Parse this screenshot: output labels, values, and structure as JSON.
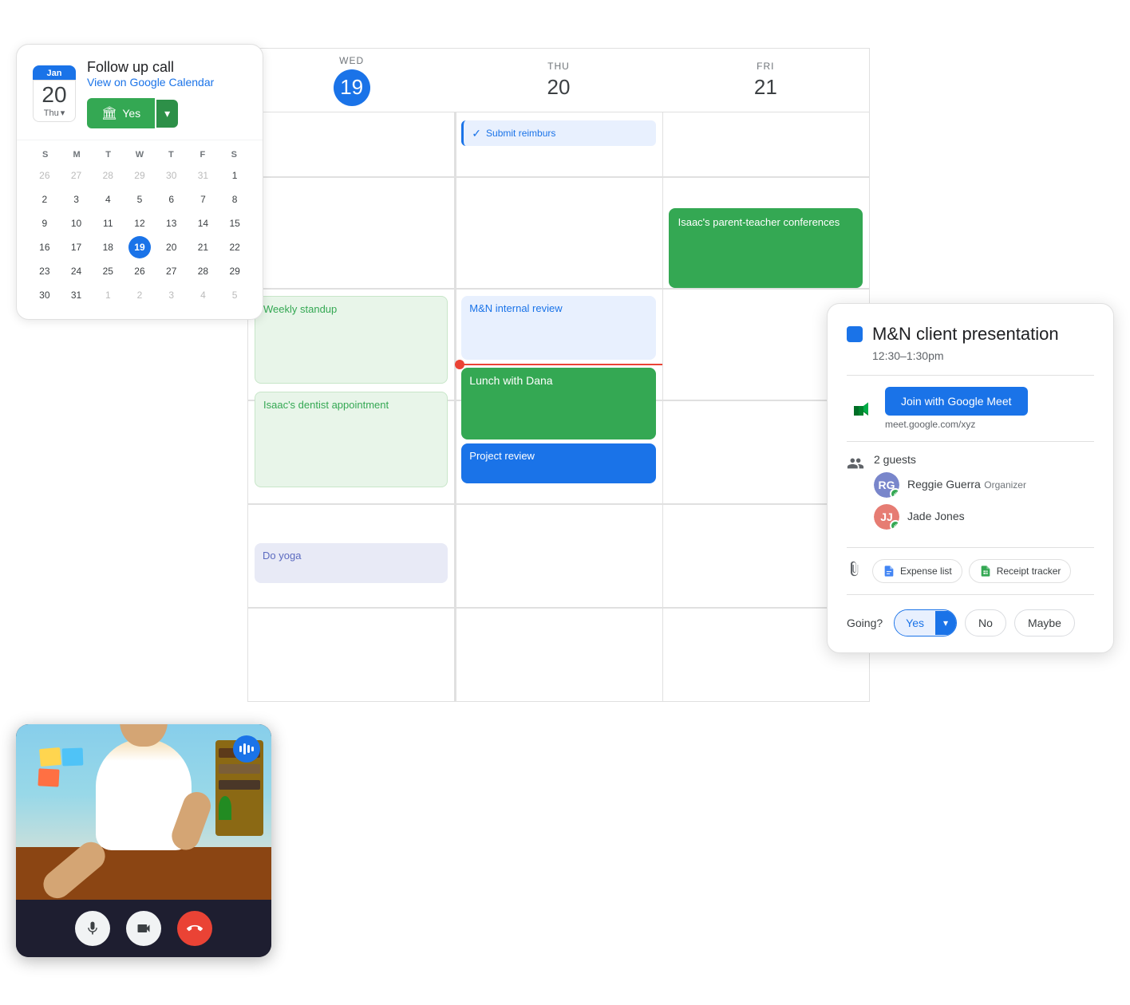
{
  "calendar": {
    "days": [
      {
        "name": "WED",
        "num": "19",
        "active": true
      },
      {
        "name": "THU",
        "num": "20",
        "active": false
      },
      {
        "name": "FRI",
        "num": "21",
        "active": false
      }
    ],
    "events": {
      "wed": [
        {
          "id": "submit",
          "label": "Submit reimburs",
          "type": "task"
        },
        {
          "id": "mn-internal",
          "label": "M&N internal review",
          "type": "blue-light"
        },
        {
          "id": "lunch-dana",
          "label": "Lunch with Dana",
          "type": "green"
        },
        {
          "id": "project-review",
          "label": "Project review",
          "type": "blue"
        }
      ],
      "thu": [
        {
          "id": "isaac-parent",
          "label": "Isaac's parent-teacher conferences",
          "type": "green-dark"
        }
      ],
      "fri": [],
      "col1": [
        {
          "id": "weekly-standup",
          "label": "Weekly standup",
          "type": "green-light"
        },
        {
          "id": "dentist",
          "label": "Isaac's dentist appointment",
          "type": "green-light"
        },
        {
          "id": "yoga",
          "label": "Do yoga",
          "type": "purple-light"
        }
      ]
    }
  },
  "mini_calendar": {
    "title": "Follow up call",
    "view_link": "View on Google Calendar",
    "month": "Jan",
    "day_num": "20",
    "day_name": "Thu",
    "rsvp_yes": "Yes",
    "headers": [
      "S",
      "M",
      "T",
      "W",
      "T",
      "F",
      "S"
    ],
    "weeks": [
      [
        "26",
        "27",
        "28",
        "29",
        "30",
        "31",
        "1"
      ],
      [
        "2",
        "3",
        "4",
        "5",
        "6",
        "7",
        "8"
      ],
      [
        "9",
        "10",
        "11",
        "12",
        "13",
        "14",
        "15"
      ],
      [
        "16",
        "17",
        "18",
        "19",
        "20",
        "21",
        "22"
      ],
      [
        "23",
        "24",
        "25",
        "26",
        "27",
        "28",
        "29"
      ],
      [
        "30",
        "31",
        "1",
        "2",
        "3",
        "4",
        "5"
      ]
    ],
    "today_index": "19",
    "other_month_start": [
      0,
      1,
      2,
      3,
      4,
      5
    ],
    "other_month_end": [
      6
    ]
  },
  "event_detail": {
    "title": "M&N client presentation",
    "time": "12:30–1:30pm",
    "meet_btn": "Join with Google Meet",
    "meet_url": "meet.google.com/xyz",
    "guests_count": "2 guests",
    "guests": [
      {
        "name": "Reggie Guerra",
        "role": "Organizer",
        "initials": "RG",
        "color": "#7986cb"
      },
      {
        "name": "Jade Jones",
        "initials": "JJ",
        "color": "#e67c73",
        "role": ""
      }
    ],
    "attachments": [
      {
        "label": "Expense list",
        "icon": "docs"
      },
      {
        "label": "Receipt tracker",
        "icon": "sheets"
      }
    ],
    "going_label": "Going?",
    "rsvp": {
      "yes": "Yes",
      "no": "No",
      "maybe": "Maybe"
    }
  },
  "video_call": {
    "controls": {
      "mic": "🎤",
      "camera": "📷",
      "hangup": "📞"
    }
  }
}
